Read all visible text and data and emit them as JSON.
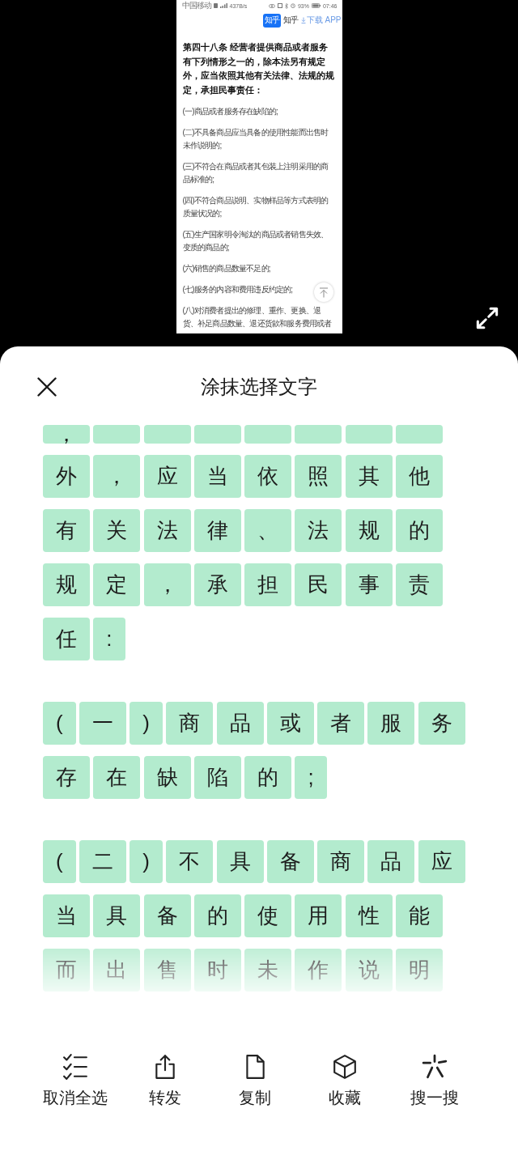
{
  "preview": {
    "status_bar": {
      "carrier": "中国移动",
      "speed": "437B/s",
      "battery": "93%",
      "time": "07:46"
    },
    "app_bar": {
      "logo": "知乎",
      "name": "知乎",
      "download": "下载 APP"
    },
    "article": {
      "heading": "第四十八条 经营者提供商品或者服务有下列情形之一的，除本法另有规定外，应当依照其他有关法律、法规的规定，承担民事责任：",
      "paragraphs": [
        "(一)商品或者服务存在缺陷的;",
        "(二)不具备商品应当具备的使用性能而出售时未作说明的;",
        "(三)不符合在商品或者其包装上注明采用的商品标准的;",
        "(四)不符合商品说明、实物样品等方式表明的质量状况的;",
        "(五)生产国家明令淘汰的商品或者销售失效、变质的商品的;",
        "(六)销售的商品数量不足的;",
        "(七)服务的内容和费用违反约定的;",
        "(八)对消费者提出的修理、重作、更换、退货、补足商品数量、退还货款和服务费用或者"
      ]
    }
  },
  "sheet": {
    "title": "涂抹选择文字",
    "paragraphs": [
      {
        "lines": [
          {
            "cut_off": true,
            "tiles": [
              {
                "text": "，",
                "selected": true
              },
              {
                "selected": true
              },
              {
                "selected": true
              },
              {
                "selected": true
              },
              {
                "selected": true
              },
              {
                "selected": true
              },
              {
                "selected": true
              },
              {
                "selected": true
              }
            ]
          },
          {
            "cut_off": false,
            "tiles": [
              {
                "text": "外",
                "selected": true
              },
              {
                "text": "，",
                "selected": true
              },
              {
                "text": "应",
                "selected": true
              },
              {
                "text": "当",
                "selected": true
              },
              {
                "text": "依",
                "selected": true
              },
              {
                "text": "照",
                "selected": true
              },
              {
                "text": "其",
                "selected": true
              },
              {
                "text": "他",
                "selected": true
              }
            ]
          },
          {
            "cut_off": false,
            "tiles": [
              {
                "text": "有",
                "selected": true
              },
              {
                "text": "关",
                "selected": true
              },
              {
                "text": "法",
                "selected": true
              },
              {
                "text": "律",
                "selected": true
              },
              {
                "text": "、",
                "selected": true
              },
              {
                "text": "法",
                "selected": true
              },
              {
                "text": "规",
                "selected": true
              },
              {
                "text": "的",
                "selected": true
              }
            ]
          },
          {
            "cut_off": false,
            "tiles": [
              {
                "text": "规",
                "selected": true
              },
              {
                "text": "定",
                "selected": true
              },
              {
                "text": "，",
                "selected": true
              },
              {
                "text": "承",
                "selected": true
              },
              {
                "text": "担",
                "selected": true
              },
              {
                "text": "民",
                "selected": true
              },
              {
                "text": "事",
                "selected": true
              },
              {
                "text": "责",
                "selected": true
              }
            ]
          },
          {
            "cut_off": false,
            "tiles": [
              {
                "text": "任",
                "selected": true
              },
              {
                "text": ":",
                "selected": true
              }
            ]
          }
        ]
      },
      {
        "lines": [
          {
            "cut_off": false,
            "tiles": [
              {
                "text": "(",
                "selected": true
              },
              {
                "text": "一",
                "selected": true
              },
              {
                "text": ")",
                "selected": true
              },
              {
                "text": "商",
                "selected": true
              },
              {
                "text": "品",
                "selected": true
              },
              {
                "text": "或",
                "selected": true
              },
              {
                "text": "者",
                "selected": true
              },
              {
                "text": "服",
                "selected": true
              },
              {
                "text": "务",
                "selected": true
              }
            ]
          },
          {
            "cut_off": false,
            "tiles": [
              {
                "text": "存",
                "selected": true
              },
              {
                "text": "在",
                "selected": true
              },
              {
                "text": "缺",
                "selected": true
              },
              {
                "text": "陷",
                "selected": true
              },
              {
                "text": "的",
                "selected": true
              },
              {
                "text": ";",
                "selected": true
              }
            ]
          }
        ]
      },
      {
        "lines": [
          {
            "cut_off": false,
            "tiles": [
              {
                "text": "(",
                "selected": true
              },
              {
                "text": "二",
                "selected": true
              },
              {
                "text": ")",
                "selected": true
              },
              {
                "text": "不",
                "selected": true
              },
              {
                "text": "具",
                "selected": true
              },
              {
                "text": "备",
                "selected": true
              },
              {
                "text": "商",
                "selected": true
              },
              {
                "text": "品",
                "selected": true
              },
              {
                "text": "应",
                "selected": true
              }
            ]
          },
          {
            "cut_off": false,
            "tiles": [
              {
                "text": "当",
                "selected": true
              },
              {
                "text": "具",
                "selected": true
              },
              {
                "text": "备",
                "selected": true
              },
              {
                "text": "的",
                "selected": true
              },
              {
                "text": "使",
                "selected": true
              },
              {
                "text": "用",
                "selected": true
              },
              {
                "text": "性",
                "selected": true
              },
              {
                "text": "能",
                "selected": true
              }
            ]
          },
          {
            "cut_off": false,
            "tiles": [
              {
                "text": "而",
                "selected": true
              },
              {
                "text": "出",
                "selected": true
              },
              {
                "text": "售",
                "selected": true
              },
              {
                "text": "时",
                "selected": true
              },
              {
                "text": "未",
                "selected": true
              },
              {
                "text": "作",
                "selected": true
              },
              {
                "text": "说",
                "selected": true
              },
              {
                "text": "明",
                "selected": true
              }
            ]
          }
        ]
      }
    ]
  },
  "toolbar": [
    {
      "kind": "checklist",
      "label": "取消全选"
    },
    {
      "kind": "share",
      "label": "转发"
    },
    {
      "kind": "document",
      "label": "复制"
    },
    {
      "kind": "cube",
      "label": "收藏"
    },
    {
      "kind": "burst",
      "label": "搜一搜"
    }
  ]
}
